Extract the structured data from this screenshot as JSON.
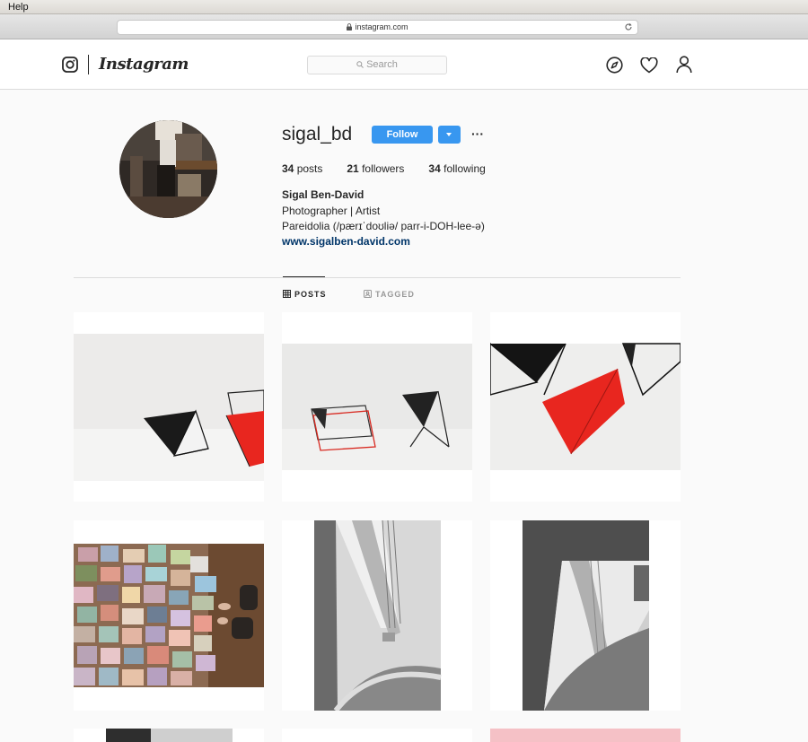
{
  "os_menu": {
    "help": "Help"
  },
  "browser": {
    "url": "instagram.com"
  },
  "nav": {
    "wordmark": "Instagram",
    "search_placeholder": "Search"
  },
  "profile": {
    "username": "sigal_bd",
    "follow_label": "Follow",
    "more_label": "···",
    "stats": [
      {
        "count": "34",
        "label": " posts"
      },
      {
        "count": "21",
        "label": " followers"
      },
      {
        "count": "34",
        "label": " following"
      }
    ],
    "full_name": "Sigal Ben-David",
    "bio_line1": "Photographer | Artist",
    "bio_line2": "Pareidolia (/pærɪˈdoʊliə/ parr-i-DOH-lee-ə)",
    "website": "www.sigalben-david.com"
  },
  "tabs": [
    {
      "label": "POSTS",
      "active": true
    },
    {
      "label": "TAGGED",
      "active": false
    }
  ],
  "colors": {
    "accent": "#3897f0",
    "link": "#003569",
    "red_sculpture": "#e8261f"
  }
}
